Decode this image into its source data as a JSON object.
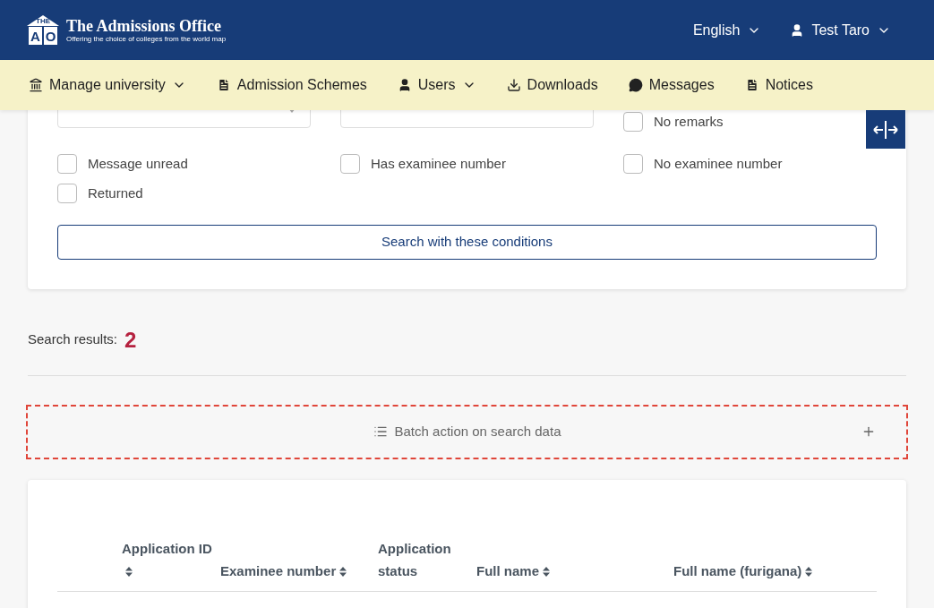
{
  "header": {
    "logo": {
      "top": "THE",
      "left": "A",
      "right": "O"
    },
    "title": "The Admissions Office",
    "tagline": "Offering the choice of colleges from the world map",
    "language": "English",
    "user": "Test Taro"
  },
  "nav": [
    {
      "kind": "bank",
      "label": "Manage university",
      "dropdown": true
    },
    {
      "kind": "file",
      "label": "Admission Schemes",
      "dropdown": false
    },
    {
      "kind": "user",
      "label": "Users",
      "dropdown": true
    },
    {
      "kind": "download",
      "label": "Downloads",
      "dropdown": false
    },
    {
      "kind": "comment",
      "label": "Messages",
      "dropdown": false
    },
    {
      "kind": "file",
      "label": "Notices",
      "dropdown": false
    }
  ],
  "filters": {
    "checkboxes": [
      {
        "label": "No remarks",
        "checked": false
      },
      {
        "label": "Message unread",
        "checked": false
      },
      {
        "label": "Has examinee number",
        "checked": false
      },
      {
        "label": "No examinee number",
        "checked": false
      },
      {
        "label": "Returned",
        "checked": false
      }
    ],
    "search_button": "Search with these conditions"
  },
  "results": {
    "label": "Search results:",
    "count": "2"
  },
  "batch_action": {
    "label": "Batch action on search data",
    "expanded": false
  },
  "table": {
    "columns": [
      {
        "label": "Application ID",
        "sortable": true
      },
      {
        "label": "Examinee number",
        "sortable": true
      },
      {
        "label": "Application status",
        "sortable": false
      },
      {
        "label": "Full name",
        "sortable": true
      },
      {
        "label": "Full name (furigana)",
        "sortable": true
      }
    ]
  }
}
